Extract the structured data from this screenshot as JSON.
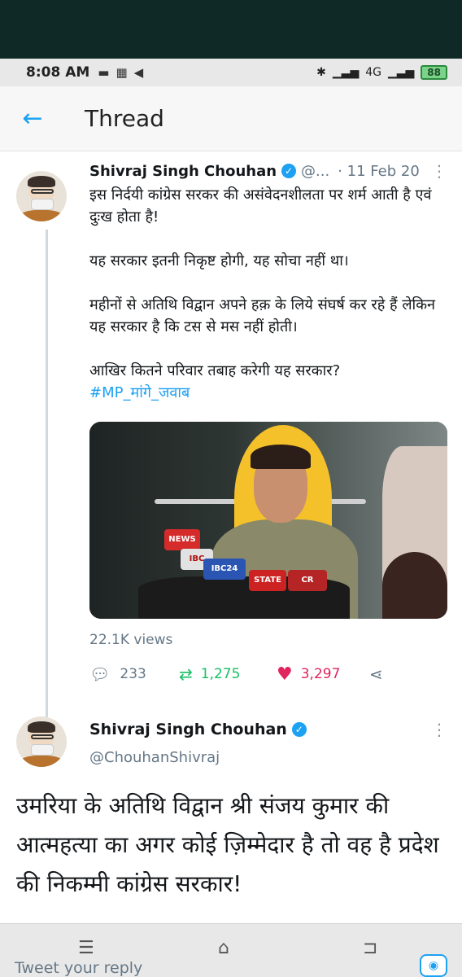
{
  "status_bar": {
    "time": "8:08 AM",
    "icons": [
      "message-icon",
      "keyboard-icon",
      "send-icon"
    ],
    "right_icons": [
      "bluetooth-icon",
      "signal-icon",
      "4g-signal-icon"
    ],
    "network": "4G",
    "battery": "88"
  },
  "header": {
    "back_icon": "arrow-left-icon",
    "title": "Thread"
  },
  "tweet1": {
    "author_name": "Shivraj Singh Chouhan",
    "handle": "@...",
    "date": "· 11 Feb 20",
    "paragraphs": [
      "इस निर्दयी कांग्रेस सरकर की असंवेदनशीलता पर शर्म आती है एवं दुःख होता है!",
      "यह सरकार इतनी निकृष्ट होगी, यह सोचा नहीं था।",
      "महीनों से अतिथि विद्वान अपने हक़ के लिये संघर्ष कर रहे हैं लेकिन यह सरकार है कि टस से मस नहीं होती।",
      "आखिर कितने परिवार तबाह करेगी यह सरकार?"
    ],
    "hashtag": "#MP_मांगे_जवाब",
    "media_mic_labels": [
      "NEWS",
      "IBC",
      "IBC24",
      "STATE",
      "CR"
    ],
    "views": "22.1K views",
    "replies": "233",
    "retweets": "1,275",
    "likes": "3,297"
  },
  "tweet2": {
    "author_name": "Shivraj Singh Chouhan",
    "handle": "@ChouhanShivraj",
    "text": "उमरिया के अतिथि विद्वान श्री संजय कुमार की आत्महत्या का अगर कोई ज़िम्मेदार है तो वह है प्रदेश की निकम्मी कांग्रेस सरकार!"
  },
  "bottom": {
    "reply_placeholder": "Tweet your reply",
    "nav_icons": [
      "menu-icon",
      "home-icon",
      "back-icon"
    ],
    "camera_icon": "camera-icon"
  },
  "colors": {
    "accent": "#1da1f2",
    "retweet": "#17bf63",
    "like": "#e0245e",
    "secondary_text": "#657786"
  }
}
